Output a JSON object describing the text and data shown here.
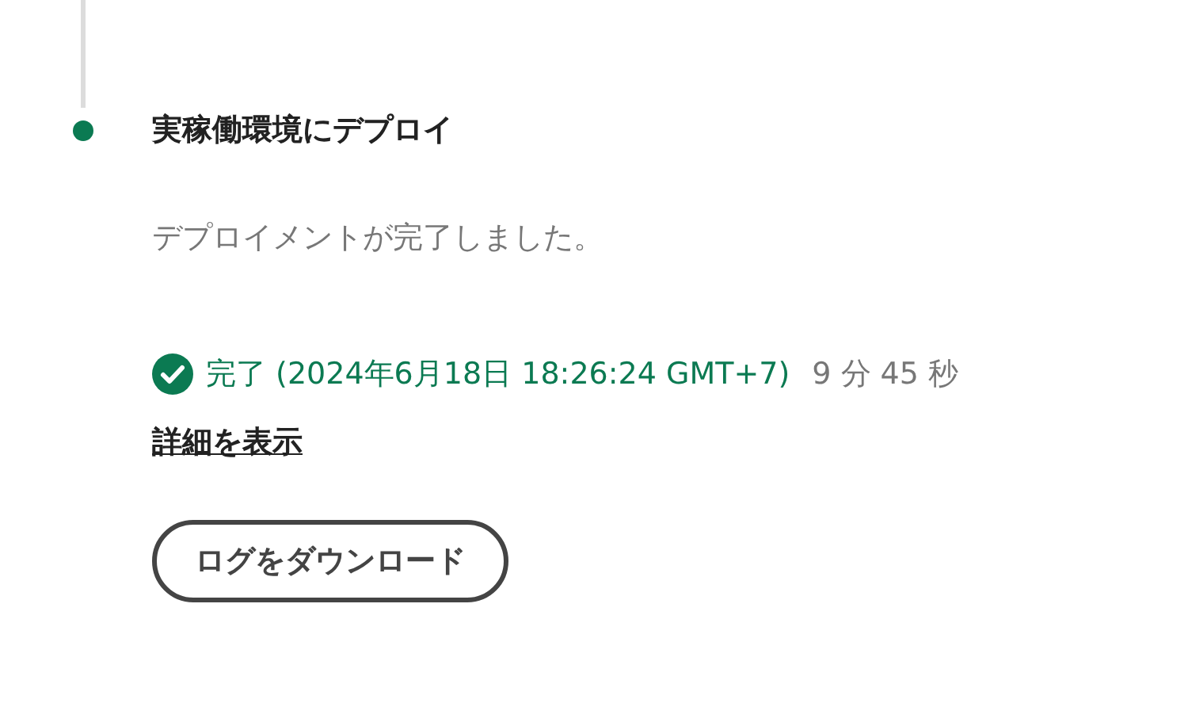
{
  "step": {
    "title": "実稼働環境にデプロイ",
    "completed": true,
    "description": "デプロイメントが完了しました。",
    "status": {
      "completed": true,
      "label": "完了 (2024年6月18日 18:26:24 GMT+7)",
      "duration": "9 分 45 秒"
    },
    "details_link": "詳細を表示",
    "download_button": "ログをダウンロード"
  }
}
